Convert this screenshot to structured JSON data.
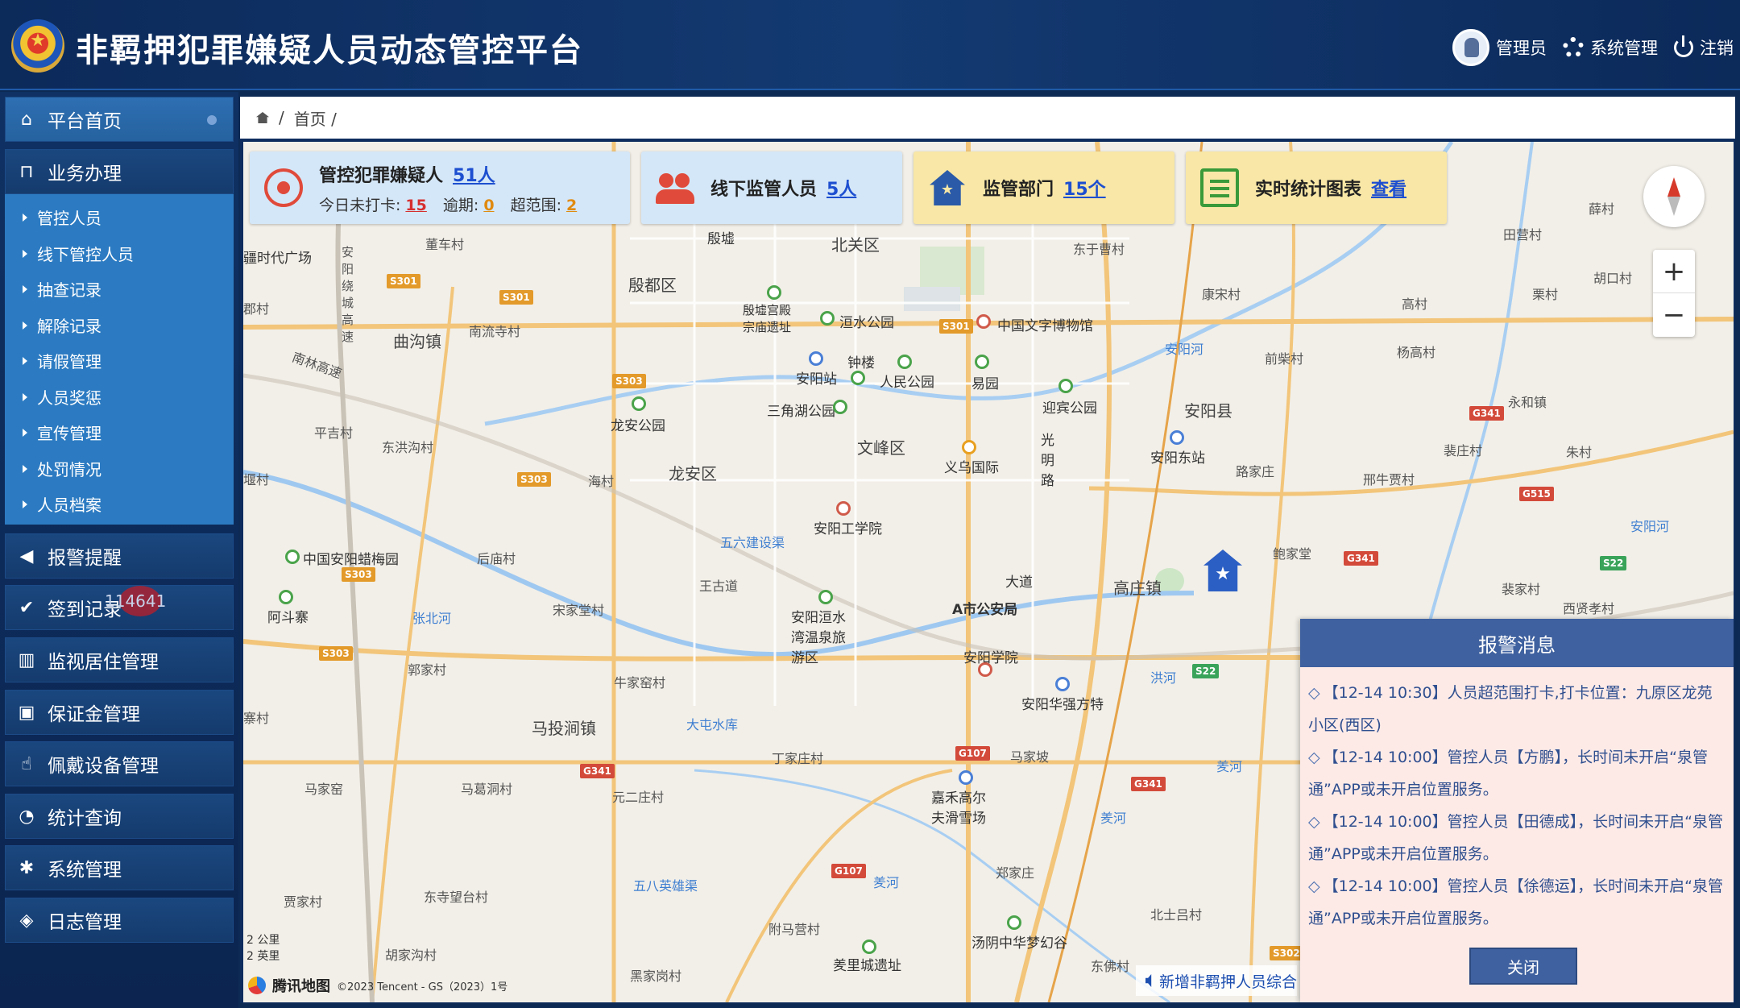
{
  "header": {
    "title": "非羁押犯罪嫌疑人员动态管控平台",
    "user_label": "管理员",
    "settings_label": "系统管理",
    "logout_label": "注销"
  },
  "sidebar": {
    "items": [
      {
        "label": "平台首页",
        "icon": "home-icon"
      },
      {
        "label": "业务办理",
        "icon": "bookmark-icon"
      },
      {
        "label": "报警提醒",
        "icon": "speaker-icon"
      },
      {
        "label": "签到记录",
        "icon": "check-icon"
      },
      {
        "label": "监视居住管理",
        "icon": "bank-icon"
      },
      {
        "label": "保证金管理",
        "icon": "money-icon"
      },
      {
        "label": "佩戴设备管理",
        "icon": "thumb-icon"
      },
      {
        "label": "统计查询",
        "icon": "pie-icon"
      },
      {
        "label": "系统管理",
        "icon": "gear-icon"
      },
      {
        "label": "日志管理",
        "icon": "tag-icon"
      }
    ],
    "submenu": [
      "管控人员",
      "线下管控人员",
      "抽查记录",
      "解除记录",
      "请假管理",
      "人员奖惩",
      "宣传管理",
      "处罚情况",
      "人员档案"
    ],
    "badge": "114641"
  },
  "breadcrumb": {
    "sep": "/",
    "current": "首页 /"
  },
  "cards": {
    "suspects": {
      "title": "管控犯罪嫌疑人",
      "count": "51人",
      "unchecked_label": "今日未打卡:",
      "unchecked": "15",
      "overdue_label": "逾期:",
      "overdue": "0",
      "outrange_label": "超范围:",
      "outrange": "2"
    },
    "offline": {
      "title": "线下监管人员",
      "count": "5人"
    },
    "dept": {
      "title": "监管部门",
      "count": "15个"
    },
    "stats": {
      "title": "实时统计图表",
      "link": "查看"
    }
  },
  "map": {
    "labels": {
      "l1": "殷墟",
      "l2": "北关区",
      "l3": "殷都区",
      "l4": "殷墟宫殿宗庙遗址",
      "l5": "洹水公园",
      "l6": "中国文字博物馆",
      "l7": "安阳站",
      "l8": "钟楼",
      "l9": "人民公园",
      "l10": "易园",
      "l11": "迎宾公园",
      "l12": "龙安公园",
      "l13": "三角湖公园",
      "l14": "文峰区",
      "l15": "义乌国际",
      "l16": "光明路",
      "l17": "安阳县",
      "l18": "安阳东站",
      "l19": "龙安区",
      "l20": "安阳工学院",
      "l21": "五六建设渠",
      "l22": "中国安阳蜡梅园",
      "l23": "A市公安局",
      "l24": "高庄镇",
      "l25": "安阳洹水湾温泉旅游区",
      "l26": "安阳学院",
      "l27": "安阳华强方特",
      "l28": "大屯水库",
      "l29": "马投涧镇",
      "l30": "嘉禾高尔夫滑雪场",
      "l31": "五八英雄渠",
      "l32": "汤阴中华梦幻谷",
      "l33": "羑里城遗址",
      "l34": "曲沟镇",
      "l35": "南流寺村",
      "l36": "董车村",
      "l37": "平吉村",
      "l38": "东洪沟村",
      "l39": "海村",
      "l40": "宋家堂村",
      "l41": "王古道",
      "l42": "张北河",
      "l43": "阿斗寨",
      "l44": "郭家村",
      "l45": "牛家窑村",
      "l46": "马家窑",
      "l47": "马葛洞村",
      "l48": "元二庄村",
      "l49": "丁家庄村",
      "l50": "马家坡",
      "l51": "贾家村",
      "l52": "东寺望台村",
      "l53": "附马营村",
      "l54": "胡家沟村",
      "l55": "黑家岗村",
      "l56": "郑家庄",
      "l57": "北士吕村",
      "l58": "东佛村",
      "l59": "安阳河",
      "l60": "前柴村",
      "l61": "杨高村",
      "l62": "康宋村",
      "l63": "东于曹村",
      "l64": "高村",
      "l65": "裴庄村",
      "l66": "邢牛贾村",
      "l67": "路家庄",
      "l68": "鲍家堂",
      "l69": "裴家村",
      "l70": "西贤孝村",
      "l71": "朱村",
      "l72": "永和镇",
      "l73": "田营村",
      "l74": "胡口村",
      "l75": "薛村",
      "l76": "栗村",
      "l77": "洪河",
      "l78": "羑河",
      "l79": "安阳河",
      "l80": "大道",
      "l81": "安阳绕城高速",
      "l82": "南林高速",
      "l83": "疆时代广场",
      "l84": "郡村",
      "l85": "后庙村",
      "l86": "堰村",
      "l87": "寨村",
      "l88": "羑河",
      "l89": "羑河"
    },
    "scale_km": "2 公里",
    "scale_mi": "2 英里",
    "provider": "腾讯地图",
    "copyright": "©2023 Tencent - GS（2023）1号"
  },
  "ticker": "新增非羁押人员综合",
  "alarm": {
    "title": "报警消息",
    "items": [
      "【12-14 10:30】人员超范围打卡,打卡位置：九原区龙苑小区(西区)",
      "【12-14 10:00】管控人员【方鹏】，长时间未开启“泉管通”APP或未开启位置服务。",
      "【12-14 10:00】管控人员【田德成】，长时间未开启“泉管通”APP或未开启位置服务。",
      "【12-14 10:00】管控人员【徐德运】，长时间未开启“泉管通”APP或未开启位置服务。"
    ],
    "close_label": "关闭",
    "bullet": "◇"
  },
  "colors": {
    "accent": "#1d4fd0",
    "alarm_head": "#3f619f",
    "sidebar_active": "#2c7bc2"
  }
}
